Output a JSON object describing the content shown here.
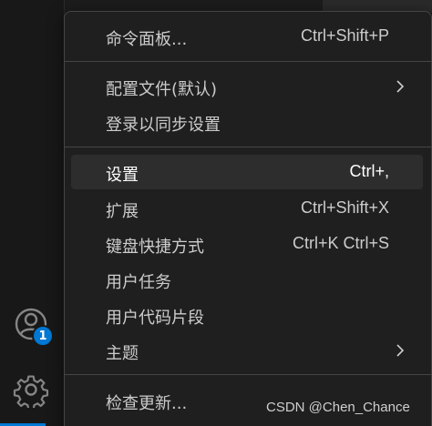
{
  "activity_bar": {
    "accounts_badge": "1"
  },
  "menu": {
    "items": [
      {
        "label": "命令面板...",
        "shortcut": "Ctrl+Shift+P"
      },
      {
        "label": "配置文件(默认)",
        "shortcut": ""
      },
      {
        "label": "登录以同步设置",
        "shortcut": ""
      },
      {
        "label": "设置",
        "shortcut": "Ctrl+,"
      },
      {
        "label": "扩展",
        "shortcut": "Ctrl+Shift+X"
      },
      {
        "label": "键盘快捷方式",
        "shortcut": "Ctrl+K Ctrl+S"
      },
      {
        "label": "用户任务",
        "shortcut": ""
      },
      {
        "label": "用户代码片段",
        "shortcut": ""
      },
      {
        "label": "主题",
        "shortcut": ""
      },
      {
        "label": "检查更新...",
        "shortcut": ""
      }
    ]
  },
  "watermark": "CSDN @Chen_Chance",
  "colors": {
    "accent": "#0078d4",
    "menu_bg": "#1f1f1f",
    "menu_text": "#cccccc",
    "selected_bg": "#2d2d2d"
  },
  "icons": {
    "accounts": "account-icon",
    "manage": "gear-icon",
    "submenu": "chevron-right-icon"
  }
}
